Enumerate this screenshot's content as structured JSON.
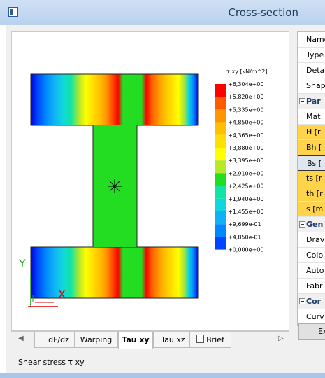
{
  "window": {
    "title": "Cross-section"
  },
  "legend": {
    "title": "τ xy [kN/m^2]",
    "labels": [
      "+6,304e+00",
      "+5,820e+00",
      "+5,335e+00",
      "+4,850e+00",
      "+4,365e+00",
      "+3,880e+00",
      "+3,395e+00",
      "+2,910e+00",
      "+2,425e+00",
      "+1,940e+00",
      "+1,455e+00",
      "+9,699e-01",
      "+4,850e-01",
      "+0,000e+00"
    ],
    "colors": [
      "#ff0000",
      "#ff5a00",
      "#ff9500",
      "#ffc000",
      "#ffdf00",
      "#ffff00",
      "#b8e82a",
      "#22dd22",
      "#11e5a6",
      "#11d6dd",
      "#11b2f5",
      "#0088ff",
      "#0044ff",
      "#0000dd"
    ]
  },
  "axes": {
    "y": "Y",
    "x": "X"
  },
  "tabs": [
    {
      "label": "dF/dz",
      "active": false
    },
    {
      "label": "Warping",
      "active": false
    },
    {
      "label": "Tau xy",
      "active": true
    },
    {
      "label": "Tau xz",
      "active": false
    },
    {
      "label": "Brief",
      "active": false
    }
  ],
  "status": {
    "text": "Shear stress τ xy"
  },
  "properties": {
    "rows": [
      {
        "label": "Name",
        "kind": "plain"
      },
      {
        "label": "Type",
        "kind": "plain"
      },
      {
        "label": "Detai",
        "kind": "plain"
      },
      {
        "label": "Shape",
        "kind": "plain"
      },
      {
        "label": "Par",
        "kind": "cat"
      },
      {
        "label": "Mat",
        "kind": "plain"
      },
      {
        "label": "H [r",
        "kind": "hl"
      },
      {
        "label": "Bh [",
        "kind": "hl"
      },
      {
        "label": "Bs [",
        "kind": "sel"
      },
      {
        "label": "ts [r",
        "kind": "hl"
      },
      {
        "label": "th [r",
        "kind": "hl"
      },
      {
        "label": "s [m",
        "kind": "hl"
      },
      {
        "label": "Gen",
        "kind": "cat"
      },
      {
        "label": "Drav",
        "kind": "plain"
      },
      {
        "label": "Colo",
        "kind": "plain"
      },
      {
        "label": "Auto",
        "kind": "plain"
      },
      {
        "label": "Fabr",
        "kind": "plain"
      },
      {
        "label": "Cor",
        "kind": "cat"
      },
      {
        "label": "Curv",
        "kind": "plain"
      }
    ],
    "button_label": "Ex"
  }
}
